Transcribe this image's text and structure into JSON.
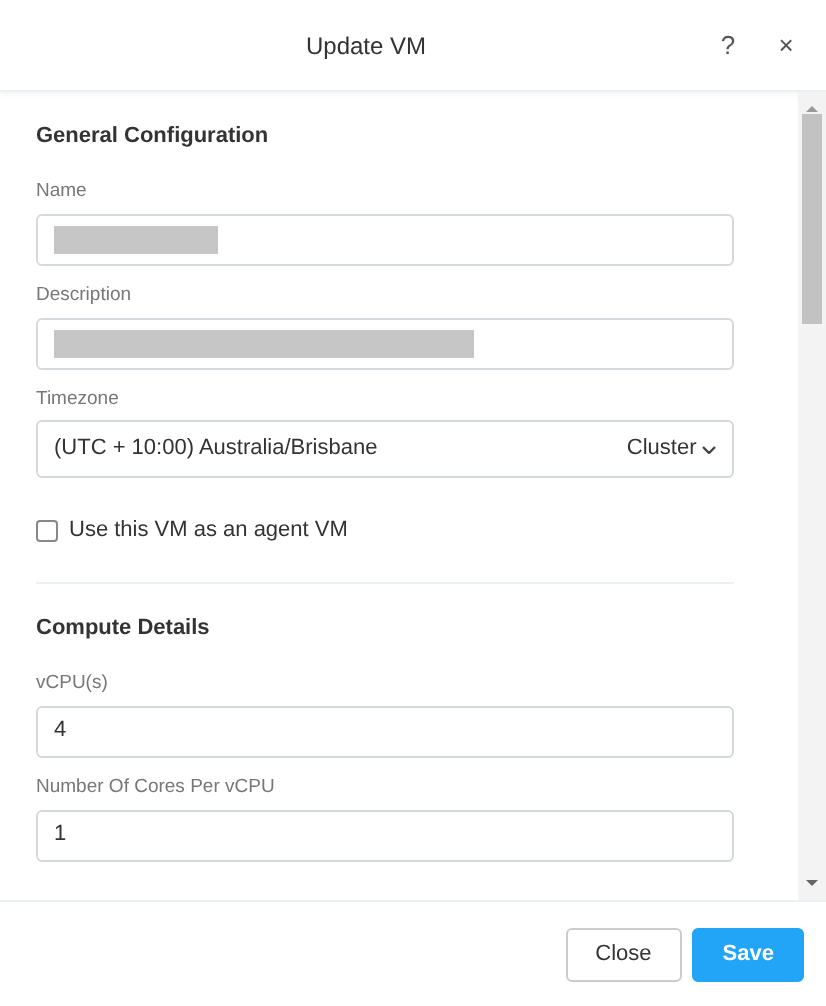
{
  "dialog": {
    "title": "Update VM",
    "help": "?",
    "close": "×"
  },
  "sections": [
    {
      "title": "General Configuration",
      "fields": [
        {
          "kind": "text",
          "label": "Name",
          "redacted": true
        },
        {
          "kind": "text",
          "label": "Description",
          "redacted": true
        },
        {
          "kind": "select",
          "label": "Timezone",
          "value": "(UTC + 10:00) Australia/Brisbane",
          "addon": "Cluster"
        },
        {
          "kind": "checkbox",
          "label": "Use this VM as an agent VM",
          "checked": false
        }
      ]
    },
    {
      "title": "Compute Details",
      "fields": [
        {
          "kind": "text",
          "label": "vCPU(s)",
          "value": "4"
        },
        {
          "kind": "text",
          "label": "Number Of Cores Per vCPU",
          "value": "1"
        }
      ]
    }
  ],
  "buttons": [
    {
      "label": "Close",
      "kind": "secondary"
    },
    {
      "label": "Save",
      "kind": "primary"
    }
  ]
}
